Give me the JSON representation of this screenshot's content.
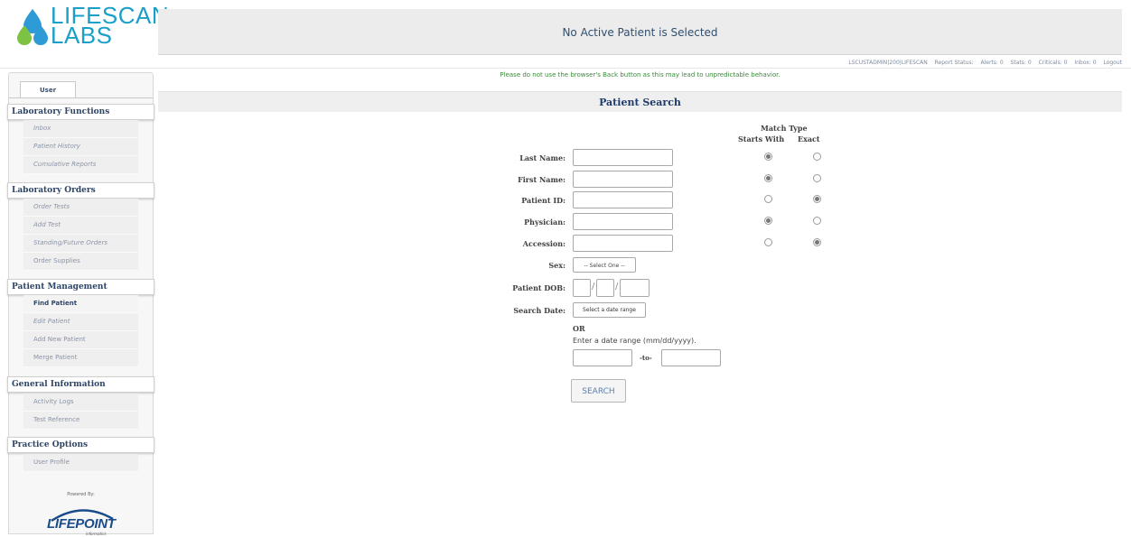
{
  "brand": {
    "line1": "LIFESCAN",
    "line2": "LABS",
    "drop_colors": [
      "#2e9bd6",
      "#7cc243"
    ]
  },
  "header": {
    "title": "No Active Patient is Selected",
    "user": "LSCUSTADMIN|200|LIFESCAN",
    "report_status": "Report Status:",
    "alerts": "Alerts: 0",
    "stats": "Stats: 0",
    "criticals": "Criticals: 0",
    "inbox": "Inbox: 0",
    "logout": "Logout",
    "warning": "Please do not use the browser's Back button as this may lead to unpredictable behavior."
  },
  "sidebar": {
    "tab": "User",
    "sections": [
      {
        "title": "Laboratory Functions",
        "items": [
          "Inbox",
          "Patient History",
          "Cumulative Reports"
        ]
      },
      {
        "title": "Laboratory Orders",
        "items": [
          "Order Tests",
          "Add Test",
          "Standing/Future Orders",
          "Order Supplies"
        ]
      },
      {
        "title": "Patient Management",
        "items": [
          "Find Patient",
          "Edit Patient",
          "Add New Patient",
          "Merge Patient"
        ]
      },
      {
        "title": "General Information",
        "items": [
          "Activity Logs",
          "Test Reference"
        ]
      },
      {
        "title": "Practice Options",
        "items": [
          "User Profile"
        ]
      }
    ],
    "active_item": "Find Patient",
    "powered_by": "Powered By:",
    "lifepoint": "LIFEPOINT",
    "lifepoint_sub": "informatics"
  },
  "search": {
    "title": "Patient Search",
    "match_type": "Match Type",
    "starts_with": "Starts With",
    "exact": "Exact",
    "fields": [
      {
        "label": "Last Name:",
        "value": "",
        "match": "starts_with"
      },
      {
        "label": "First Name:",
        "value": "",
        "match": "starts_with"
      },
      {
        "label": "Patient ID:",
        "value": "",
        "match": "exact"
      },
      {
        "label": "Physician:",
        "value": "",
        "match": "starts_with"
      },
      {
        "label": "Accession:",
        "value": "",
        "match": "exact"
      }
    ],
    "sex_label": "Sex:",
    "sex_value": "-- Select One --",
    "dob_label": "Patient DOB:",
    "date_label": "Search Date:",
    "date_button": "Select a date range",
    "or": "OR",
    "range_hint": "Enter a date range (mm/dd/yyyy).",
    "to": "-to-",
    "submit": "SEARCH"
  }
}
